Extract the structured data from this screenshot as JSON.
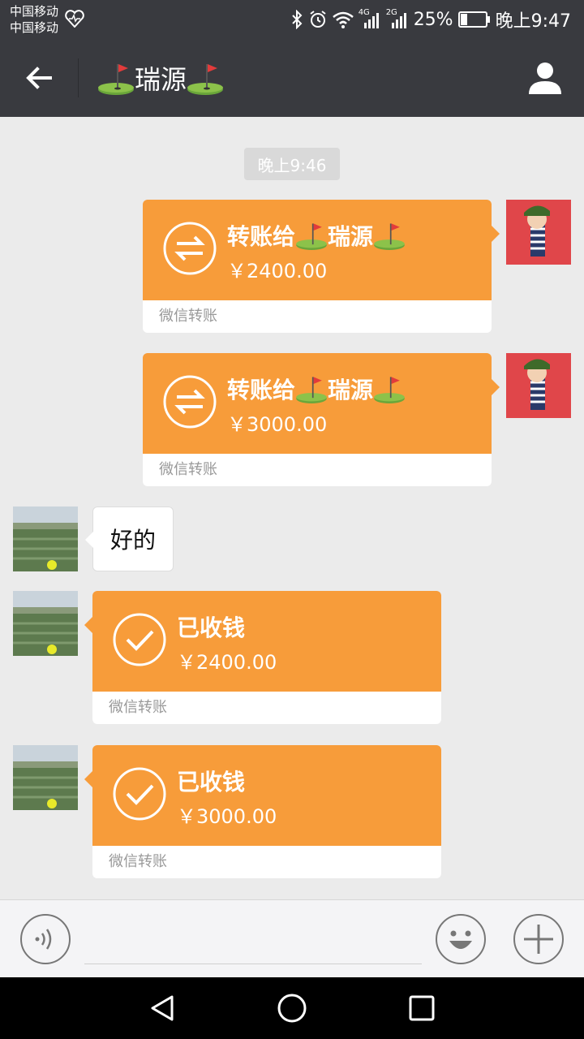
{
  "status_bar": {
    "carrier1": "中国移动",
    "carrier2": "中国移动",
    "network1": "4G",
    "network2": "2G",
    "battery": "25%",
    "time": "晚上9:47"
  },
  "header": {
    "title": "瑞源",
    "icons": [
      "back-arrow-icon",
      "golf-flag-icon",
      "contact-profile-icon"
    ]
  },
  "chat": {
    "timestamp": "晚上9:46",
    "messages": [
      {
        "side": "right",
        "type": "transfer",
        "title_prefix": "转账给",
        "recipient": "瑞源",
        "amount": "￥2400.00",
        "footer": "微信转账"
      },
      {
        "side": "right",
        "type": "transfer",
        "title_prefix": "转账给",
        "recipient": "瑞源",
        "amount": "￥3000.00",
        "footer": "微信转账"
      },
      {
        "side": "left",
        "type": "text",
        "text": "好的"
      },
      {
        "side": "left",
        "type": "received",
        "title": "已收钱",
        "amount": "￥2400.00",
        "footer": "微信转账"
      },
      {
        "side": "left",
        "type": "received",
        "title": "已收钱",
        "amount": "￥3000.00",
        "footer": "微信转账"
      }
    ]
  },
  "colors": {
    "header_bg": "#393a3f",
    "transfer_orange": "#f79c3a",
    "chat_bg": "#ebebeb"
  },
  "input_bar": {
    "icons": [
      "voice-icon",
      "emoji-icon",
      "plus-icon"
    ]
  },
  "system_nav": {
    "icons": [
      "nav-back-icon",
      "nav-home-icon",
      "nav-recent-icon"
    ]
  }
}
